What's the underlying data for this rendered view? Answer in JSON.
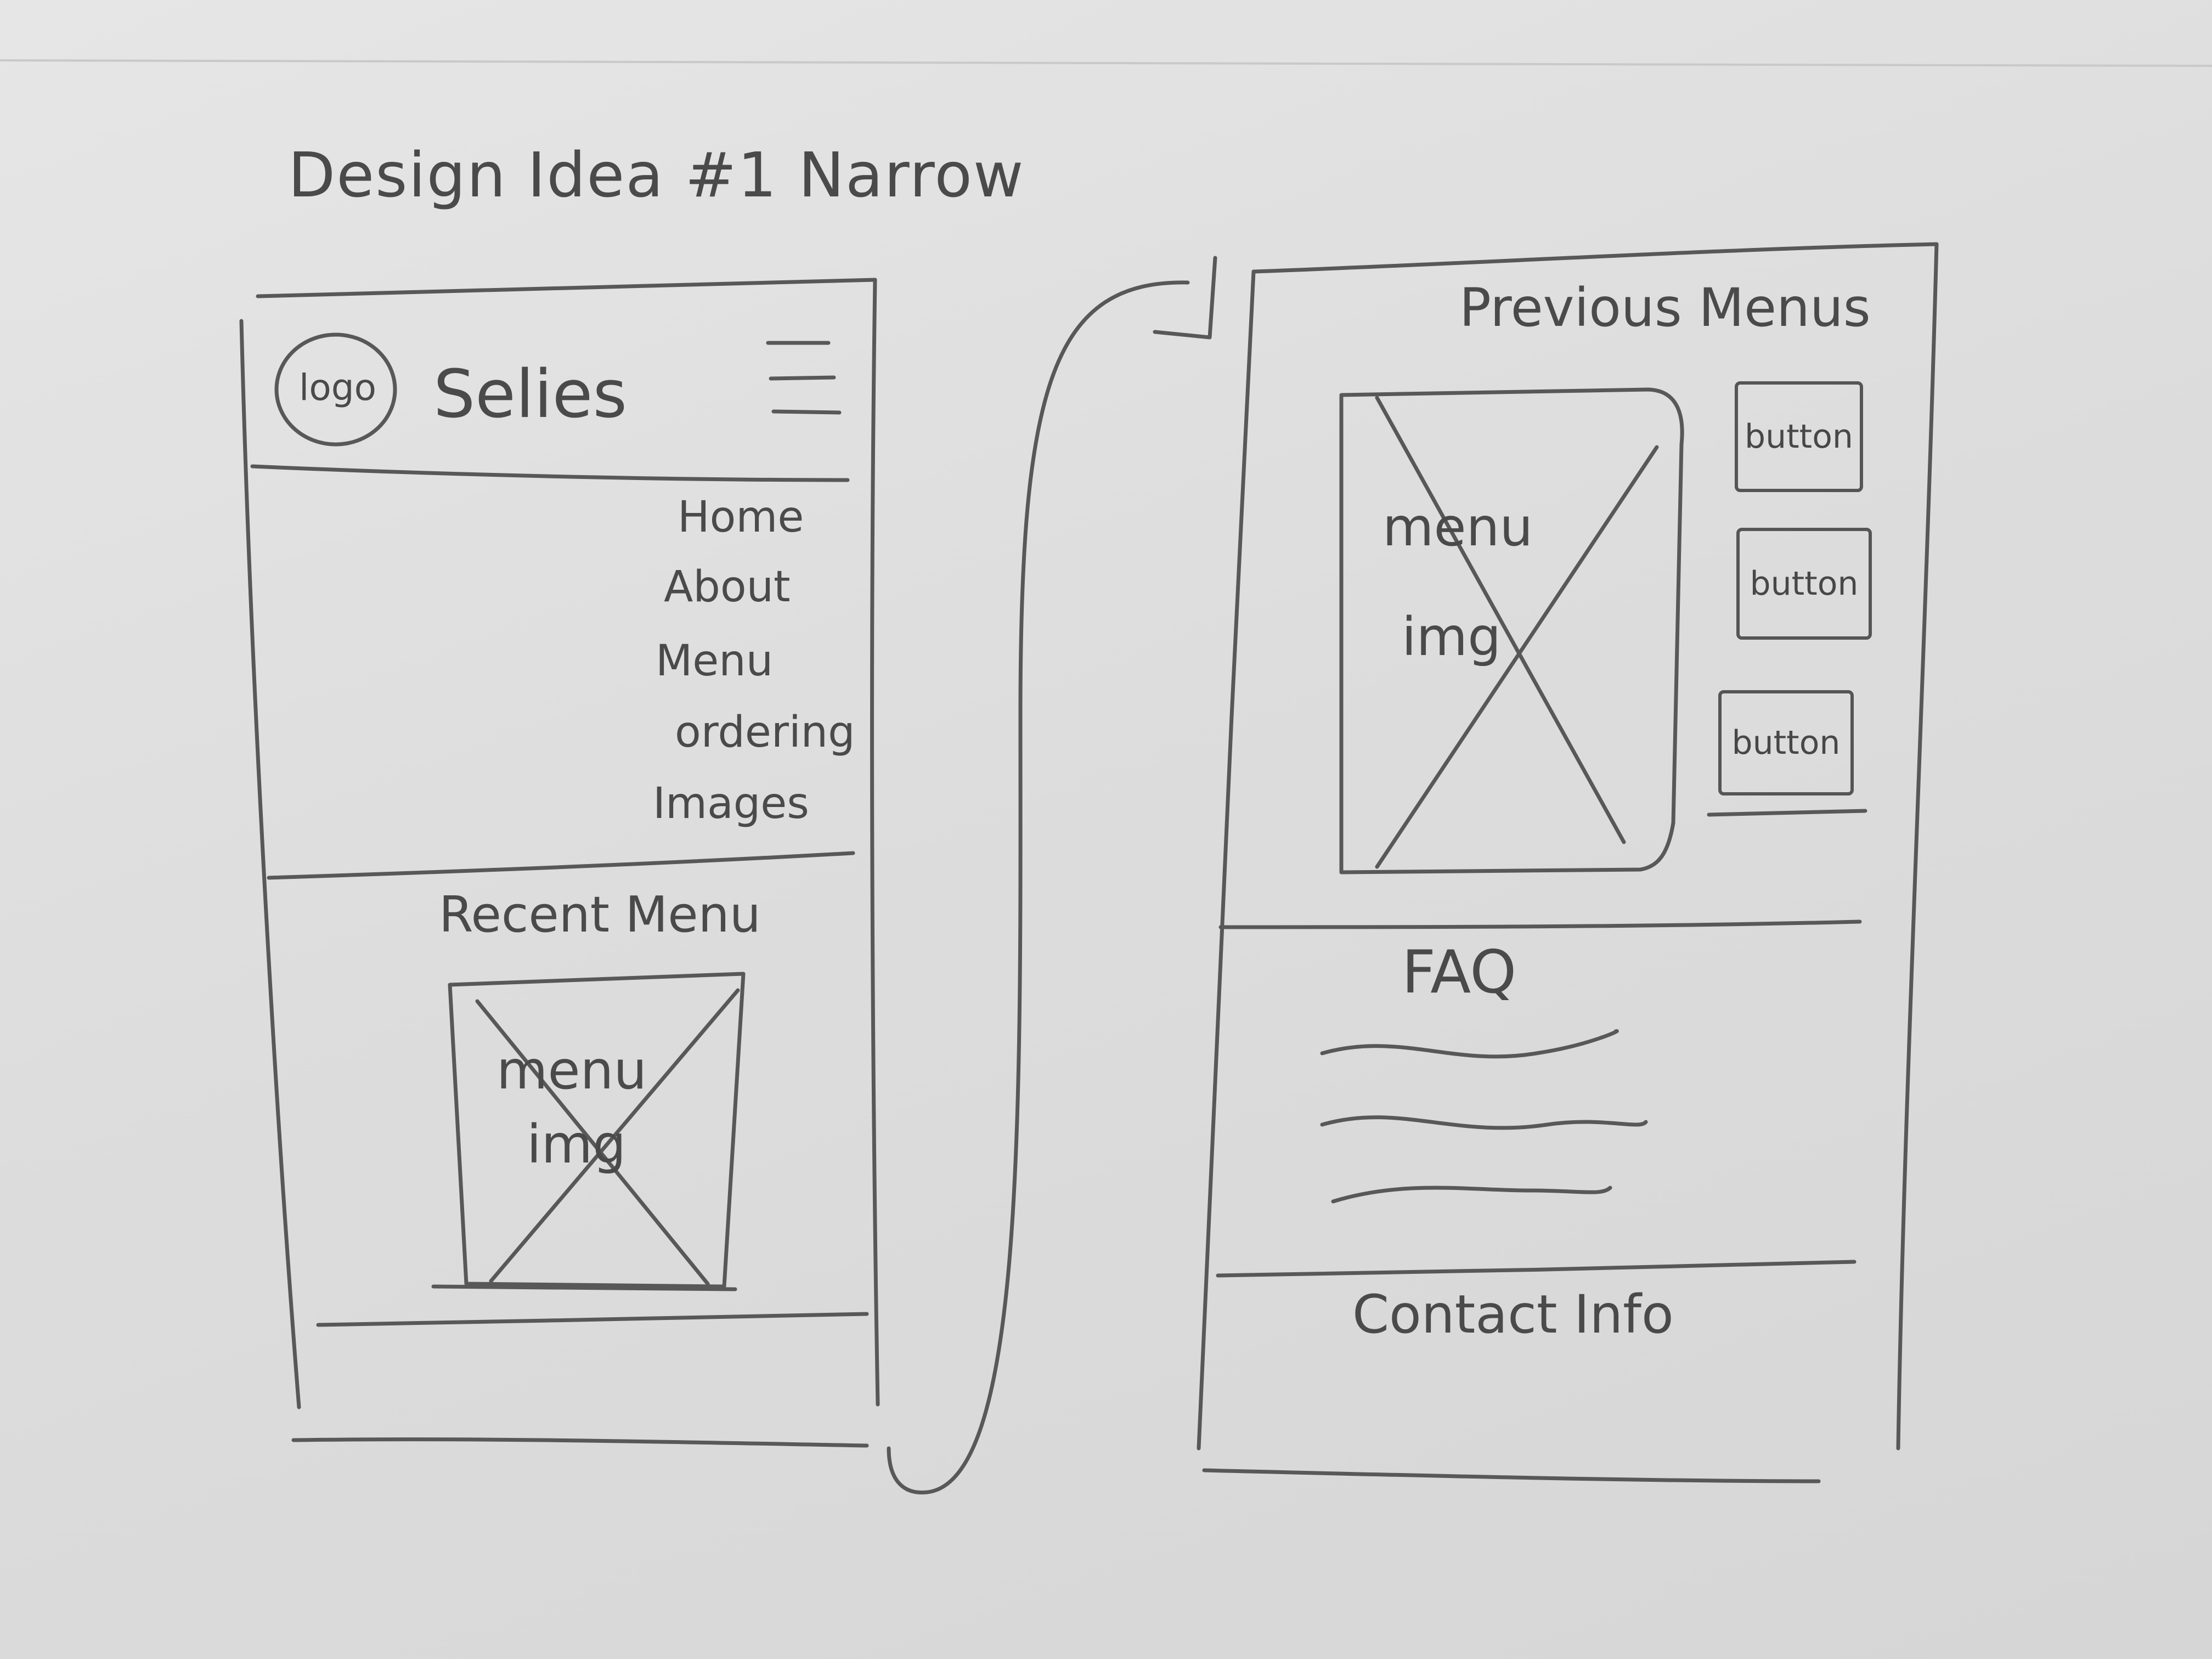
{
  "page_title": "Design Idea #1 Narrow",
  "left_phone": {
    "logo_text": "logo",
    "site_name": "Selies",
    "menu_icon": "hamburger-icon",
    "nav_items": [
      "Home",
      "About",
      "Menu",
      "ordering",
      "Images"
    ],
    "recent_menu_title": "Recent Menu",
    "image_label_line1": "menu",
    "image_label_line2": "img"
  },
  "right_phone": {
    "previous_menus_title": "Previous Menus",
    "image_label_line1": "menu",
    "image_label_line2": "img",
    "buttons": [
      "button",
      "button",
      "button"
    ],
    "faq_title": "FAQ",
    "contact_title": "Contact Info"
  }
}
